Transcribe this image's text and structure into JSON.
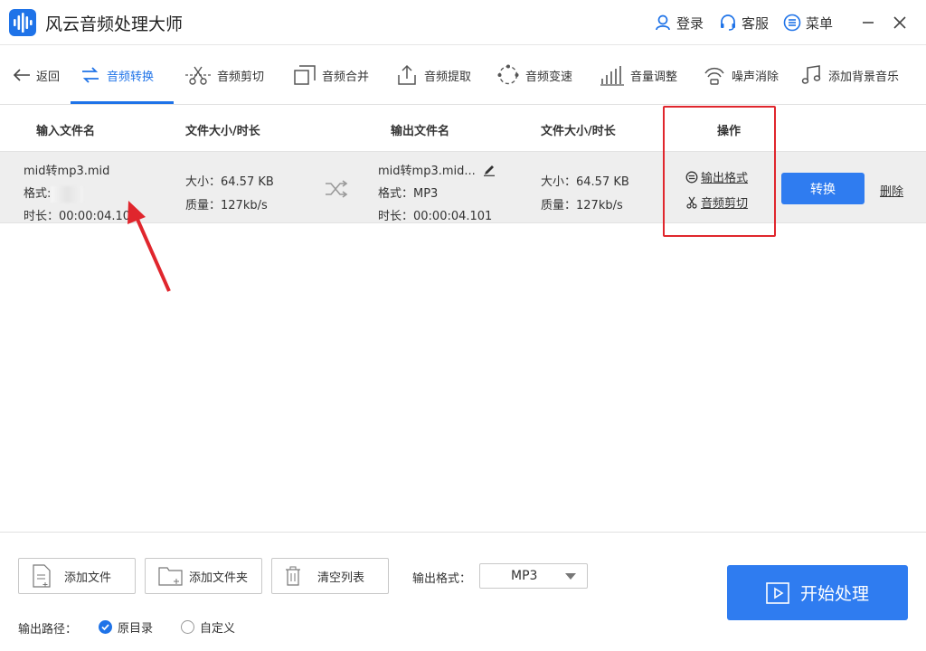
{
  "app": {
    "title": "风云音频处理大师"
  },
  "titlebar": {
    "login": "登录",
    "service": "客服",
    "menu": "菜单"
  },
  "toolbar": {
    "back": "返回",
    "tools": [
      "音频转换",
      "音频剪切",
      "音频合并",
      "音频提取",
      "音频变速",
      "音量调整",
      "噪声消除",
      "添加背景音乐"
    ]
  },
  "table": {
    "headers": [
      "输入文件名",
      "文件大小/时长",
      "输出文件名",
      "文件大小/时长",
      "操作"
    ],
    "rows": [
      {
        "input_name": "mid转mp3.mid",
        "input_format_label": "格式:",
        "input_duration": "时长：00:00:04.101",
        "input_size": "大小：64.57 KB",
        "input_quality": "质量：127kb/s",
        "output_name": "mid转mp3.mid...",
        "output_format": "格式：MP3",
        "output_duration": "时长：00:00:04.101",
        "output_size": "大小：64.57 KB",
        "output_quality": "质量：127kb/s",
        "action_output_format": "输出格式",
        "action_audio_cut": "音频剪切",
        "convert": "转换",
        "delete": "删除"
      }
    ]
  },
  "bottom": {
    "add_file": "添加文件",
    "add_folder": "添加文件夹",
    "clear_list": "清空列表",
    "output_format_label": "输出格式：",
    "output_format_value": "MP3",
    "start": "开始处理",
    "output_path_label": "输出路径：",
    "path_options": [
      "原目录",
      "自定义"
    ],
    "path_selected": "原目录"
  },
  "colors": {
    "accent": "#1f73e8",
    "button": "#2f7cf0",
    "highlight": "#e0262d",
    "row_bg": "#eeeeee"
  }
}
